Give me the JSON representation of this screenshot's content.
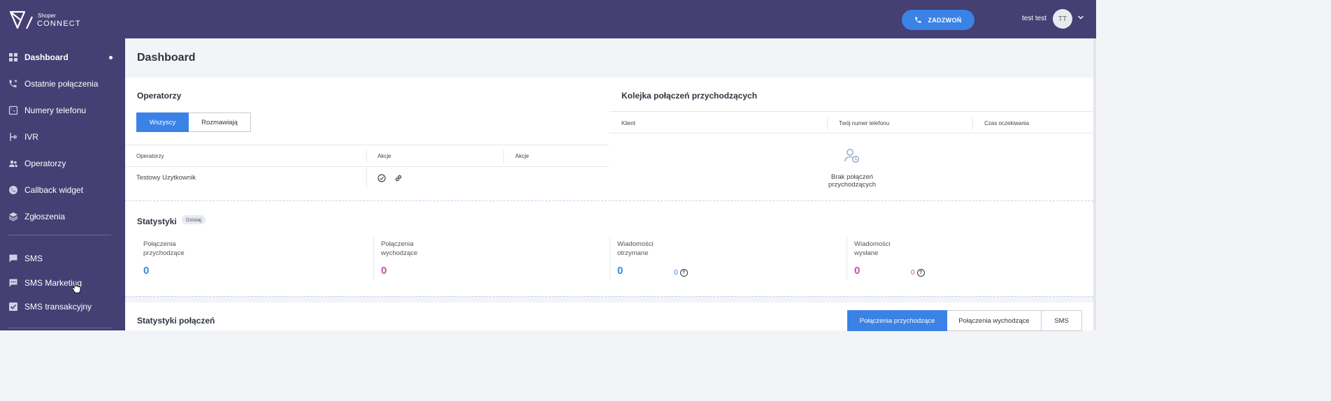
{
  "brand": {
    "small": "Shoper",
    "big": "CONNECT"
  },
  "header": {
    "call_label": "ZADZWOŃ",
    "user_name": "test test",
    "avatar_initials": "TT"
  },
  "sidebar": {
    "items": [
      {
        "label": "Dashboard",
        "icon": "dashboard-icon"
      },
      {
        "label": "Ostatnie połączenia",
        "icon": "phone-calls-icon"
      },
      {
        "label": "Numery telefonu",
        "icon": "phone-number-icon"
      },
      {
        "label": "IVR",
        "icon": "ivr-icon"
      },
      {
        "label": "Operatorzy",
        "icon": "users-icon"
      },
      {
        "label": "Callback widget",
        "icon": "callback-icon"
      },
      {
        "label": "Zgłoszenia",
        "icon": "layers-icon"
      },
      {
        "label": "SMS",
        "icon": "sms-icon"
      },
      {
        "label": "SMS Marketing",
        "icon": "sms-marketing-icon"
      },
      {
        "label": "SMS transakcyjny",
        "icon": "sms-transactional-icon"
      }
    ]
  },
  "page": {
    "title": "Dashboard"
  },
  "operators": {
    "title": "Operatorzy",
    "tabs": [
      "Wszyscy",
      "Rozmawiają"
    ],
    "columns": [
      "Operatorzy",
      "Akcje",
      "Akcje"
    ],
    "rows": [
      {
        "name": "Testowy Uzytkownik"
      }
    ]
  },
  "queue": {
    "title": "Kolejka połączeń przychodzących",
    "columns": [
      "Klient",
      "Twój numer telefonu",
      "Czas oczekiwania"
    ],
    "empty": "Brak połączeń przychodzących"
  },
  "stats": {
    "title": "Statystyki",
    "badge": "Dzisiaj",
    "items": [
      {
        "label": "Połączenia\nprzychodzące",
        "value": "0"
      },
      {
        "label": "Połączenia\nwychodzące",
        "value": "0"
      },
      {
        "label": "Wiadomości\notrzymane",
        "value": "0",
        "sub": "0"
      },
      {
        "label": "Wiadomości\nwysłane",
        "value": "0",
        "sub": "0"
      }
    ],
    "colors": {
      "blue": "#3b82e6",
      "pink": "#c54dae"
    }
  },
  "call_stats": {
    "title": "Statystyki połączeń",
    "tabs": [
      "Połączenia przychodzące",
      "Połączenia wychodzące",
      "SMS"
    ]
  }
}
